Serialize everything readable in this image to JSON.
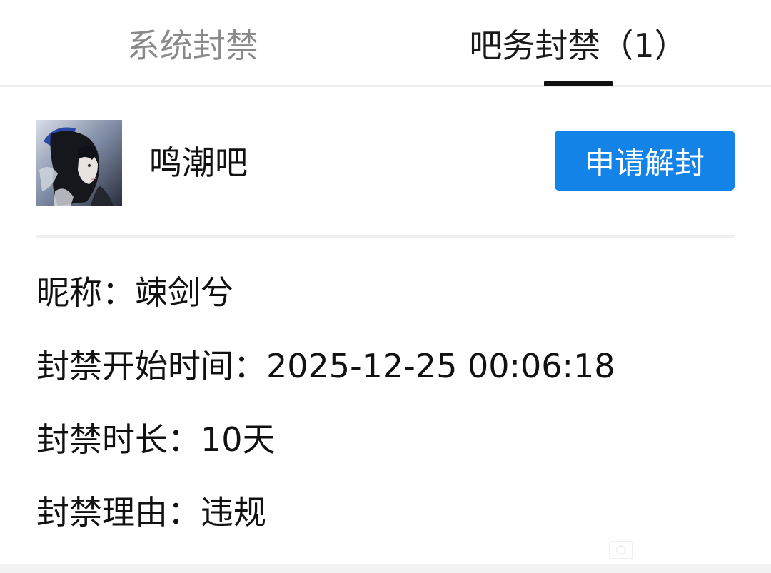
{
  "tabs": {
    "system_ban": "系统封禁",
    "bar_ban": "吧务封禁（1）"
  },
  "forum": {
    "name": "鸣潮吧",
    "avatar_icon": "anime-character-avatar",
    "unban_label": "申请解封"
  },
  "details": {
    "nickname": "昵称：竦剑兮",
    "start_time": "封禁开始时间：2025-12-25 00:06:18",
    "duration": "封禁时长：10天",
    "reason": "封禁理由：违规"
  },
  "colors": {
    "accent": "#1383e8",
    "inactive_tab": "#8a8a8a",
    "text": "#111111",
    "divider": "#efefef"
  }
}
